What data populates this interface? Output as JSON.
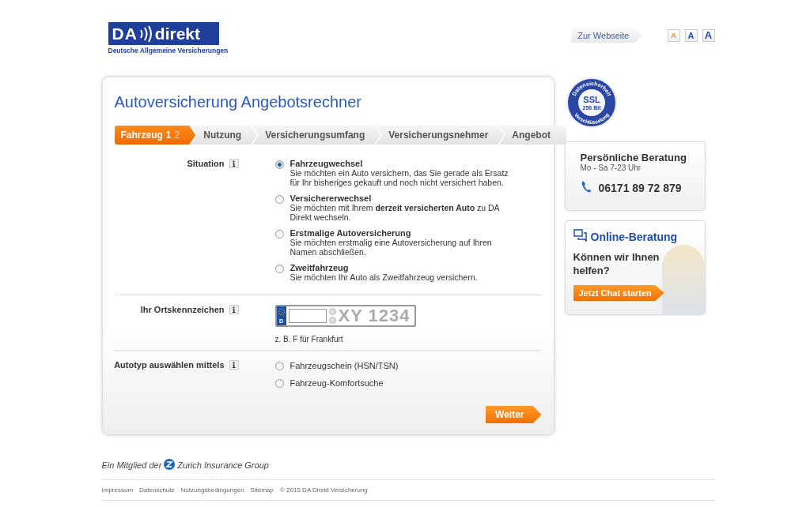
{
  "header": {
    "logo": {
      "brand_left": "DA",
      "brand_right": "direkt",
      "tagline": "Deutsche Allgemeine Versicherungen"
    },
    "website_link": "Zur Webseite",
    "font_sizes": [
      {
        "label": "A",
        "selected": true
      },
      {
        "label": "A",
        "selected": false
      },
      {
        "label": "A",
        "selected": false
      }
    ]
  },
  "form": {
    "title": "Autoversicherung Angebotsrechner",
    "steps": [
      {
        "label": "Fahrzeug",
        "selected": true,
        "substeps": [
          {
            "label": "1",
            "selected": true
          },
          {
            "label": "2",
            "selected": false
          }
        ]
      },
      {
        "label": "Nutzung",
        "selected": false
      },
      {
        "label": "Versicherungsumfang",
        "selected": false
      },
      {
        "label": "Versicherungsnehmer",
        "selected": false
      },
      {
        "label": "Angebot",
        "selected": false
      }
    ],
    "situation": {
      "label": "Situation",
      "options": [
        {
          "title": "Fahrzeugwechsel",
          "description": "Sie möchten ein Auto versichern, das Sie gerade als Ersatz für Ihr bisheriges gekauft und noch nicht versichert haben.",
          "selected": true
        },
        {
          "title": "Versichererwechsel",
          "description": "Sie möchten mit Ihrem **derzeit versicherten Auto** zu DA Direkt wechseln.",
          "selected": false
        },
        {
          "title": "Erstmalige Autoversicherung",
          "description": "Sie möchten erstmalig eine Autoversicherung auf Ihren Namen abschließen.",
          "selected": false
        },
        {
          "title": "Zweitfahrzeug",
          "description": "Sie möchten Ihr Auto als Zweitfahrzeug versichern.",
          "selected": false
        }
      ]
    },
    "plate": {
      "label": "Ihr Ortskennzeichen",
      "country": "D",
      "example": "XY 1234",
      "hint": "z. B. F für Frankfurt"
    },
    "autotyp": {
      "label": "Autotyp auswählen mittels",
      "options": [
        {
          "label": "Fahrzeugschein (HSN/TSN)",
          "selected": false
        },
        {
          "label": "Fahrzeug-Komfortsuche",
          "selected": false
        }
      ]
    },
    "next_button": "Weiter"
  },
  "sidebar": {
    "ssl_badge": {
      "top": "Datensicherheit",
      "main": "SSL",
      "sub": "256 Bit",
      "bottom": "Verschlüsselung"
    },
    "advice": {
      "title": "Persönliche Beratung",
      "hours": "Mo - Sa 7-23 Uhr",
      "phone": "06171 89 72 879"
    },
    "chat": {
      "title": "Online-Beratung",
      "question": "Können wir Ihnen helfen?",
      "button": "Jetzt Chat starten"
    }
  },
  "footer": {
    "member_prefix": "Ein Mitglied der",
    "member_group": "Zurich Insurance Group",
    "links": [
      "Impressum",
      "Datenschutz",
      "Nutzungsbedingungen",
      "Sitemap"
    ],
    "copyright": "© 2015 DA Direkt Versicherung"
  }
}
